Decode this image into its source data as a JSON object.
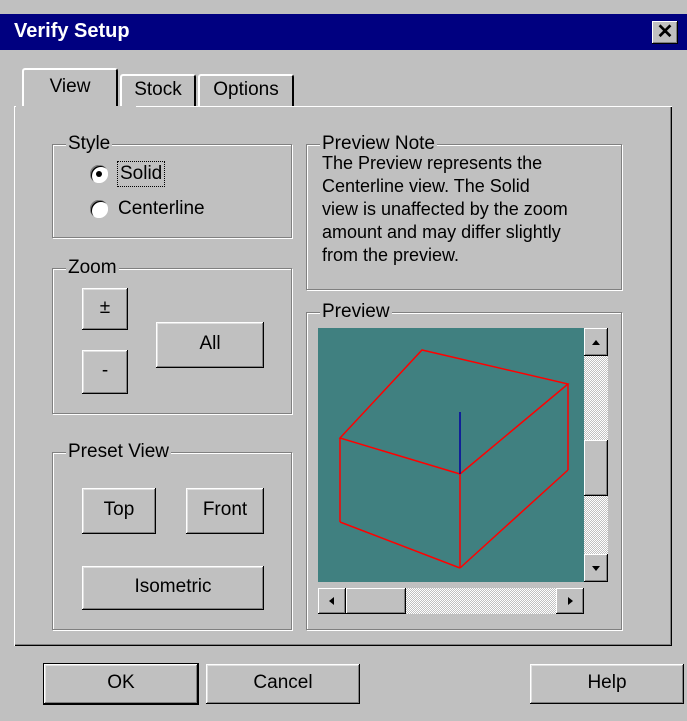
{
  "window": {
    "title": "Verify Setup",
    "close_glyph": "✕"
  },
  "tabs": [
    {
      "label": "View",
      "active": true
    },
    {
      "label": "Stock",
      "active": false
    },
    {
      "label": "Options",
      "active": false
    }
  ],
  "style_group": {
    "label": "Style",
    "options": [
      {
        "label": "Solid",
        "selected": true
      },
      {
        "label": "Centerline",
        "selected": false
      }
    ]
  },
  "zoom_group": {
    "label": "Zoom",
    "plus": "±",
    "minus": "-",
    "all": "All"
  },
  "preset_group": {
    "label": "Preset View",
    "top": "Top",
    "front": "Front",
    "isometric": "Isometric"
  },
  "preview_note": {
    "label": "Preview Note",
    "lines": [
      "The Preview represents the",
      "Centerline view.  The Solid",
      "view is unaffected by the zoom",
      "amount and may differ slightly",
      "from the preview."
    ]
  },
  "preview": {
    "label": "Preview",
    "background": "#408080",
    "edge_color": "#ff0000",
    "axis_color": "#0000a0"
  },
  "buttons": {
    "ok": "OK",
    "cancel": "Cancel",
    "help": "Help"
  }
}
